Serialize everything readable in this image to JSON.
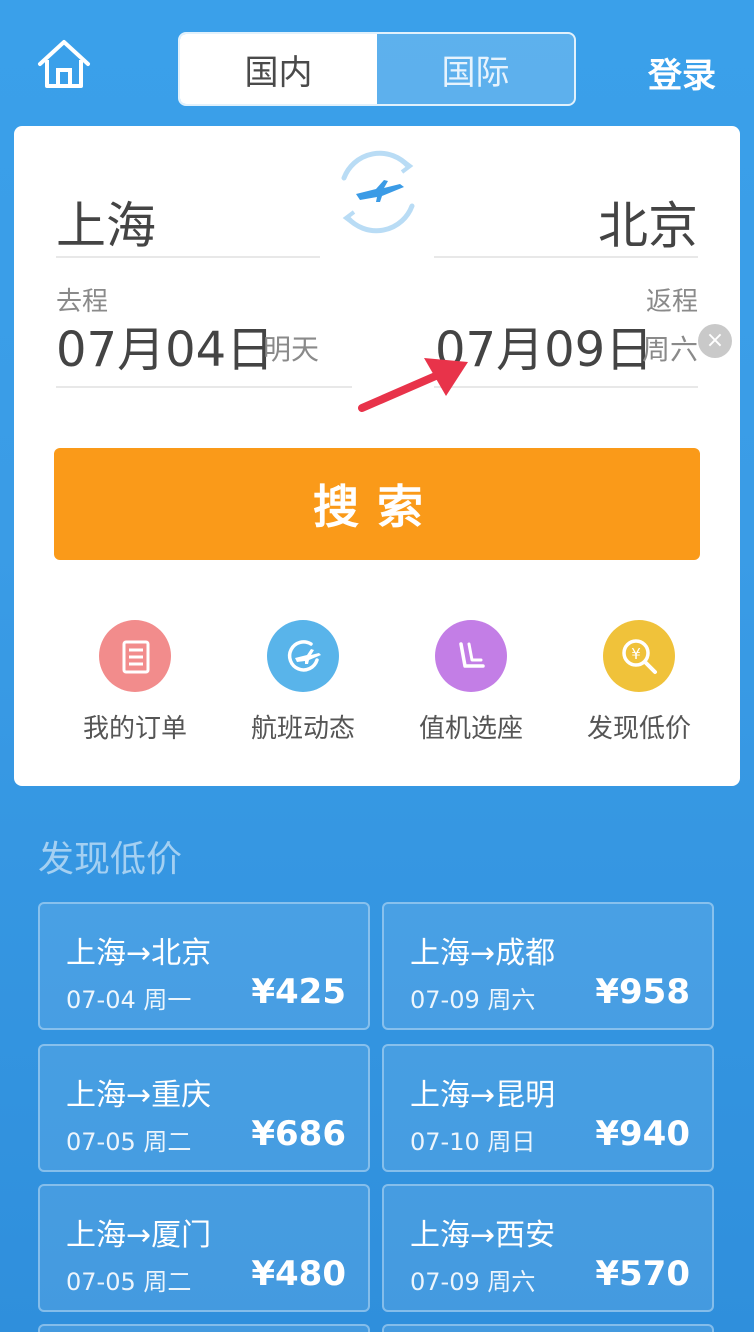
{
  "header": {
    "tabs": [
      {
        "label": "国内",
        "active": true
      },
      {
        "label": "国际",
        "active": false
      }
    ],
    "login_label": "登录",
    "home_icon": "home-icon"
  },
  "search_form": {
    "from_city": "上海",
    "to_city": "北京",
    "depart_label": "去程",
    "depart_date": "07月04日",
    "depart_weekday": "明天",
    "return_label": "返程",
    "return_date": "07月09日",
    "return_weekday": "周六",
    "clear_icon": "×",
    "search_button": "搜索"
  },
  "shortcuts": [
    {
      "label": "我的订单",
      "icon": "orders-icon",
      "color": "#f28c8c"
    },
    {
      "label": "航班动态",
      "icon": "flight-status-icon",
      "color": "#59b4ea"
    },
    {
      "label": "值机选座",
      "icon": "seat-select-icon",
      "color": "#c37ee6"
    },
    {
      "label": "发现低价",
      "icon": "low-price-icon",
      "color": "#f0c23a"
    }
  ],
  "deals_section": {
    "title": "发现低价",
    "items": [
      {
        "route": "上海→北京",
        "date": "07-04 周一",
        "price": "¥425"
      },
      {
        "route": "上海→成都",
        "date": "07-09 周六",
        "price": "¥958"
      },
      {
        "route": "上海→重庆",
        "date": "07-05 周二",
        "price": "¥686"
      },
      {
        "route": "上海→昆明",
        "date": "07-10 周日",
        "price": "¥940"
      },
      {
        "route": "上海→厦门",
        "date": "07-05 周二",
        "price": "¥480"
      },
      {
        "route": "上海→西安",
        "date": "07-09 周六",
        "price": "¥570"
      }
    ]
  },
  "colors": {
    "background": "#3a9ce6",
    "search_button": "#fa9a19",
    "annotation_arrow": "#e8334a"
  }
}
